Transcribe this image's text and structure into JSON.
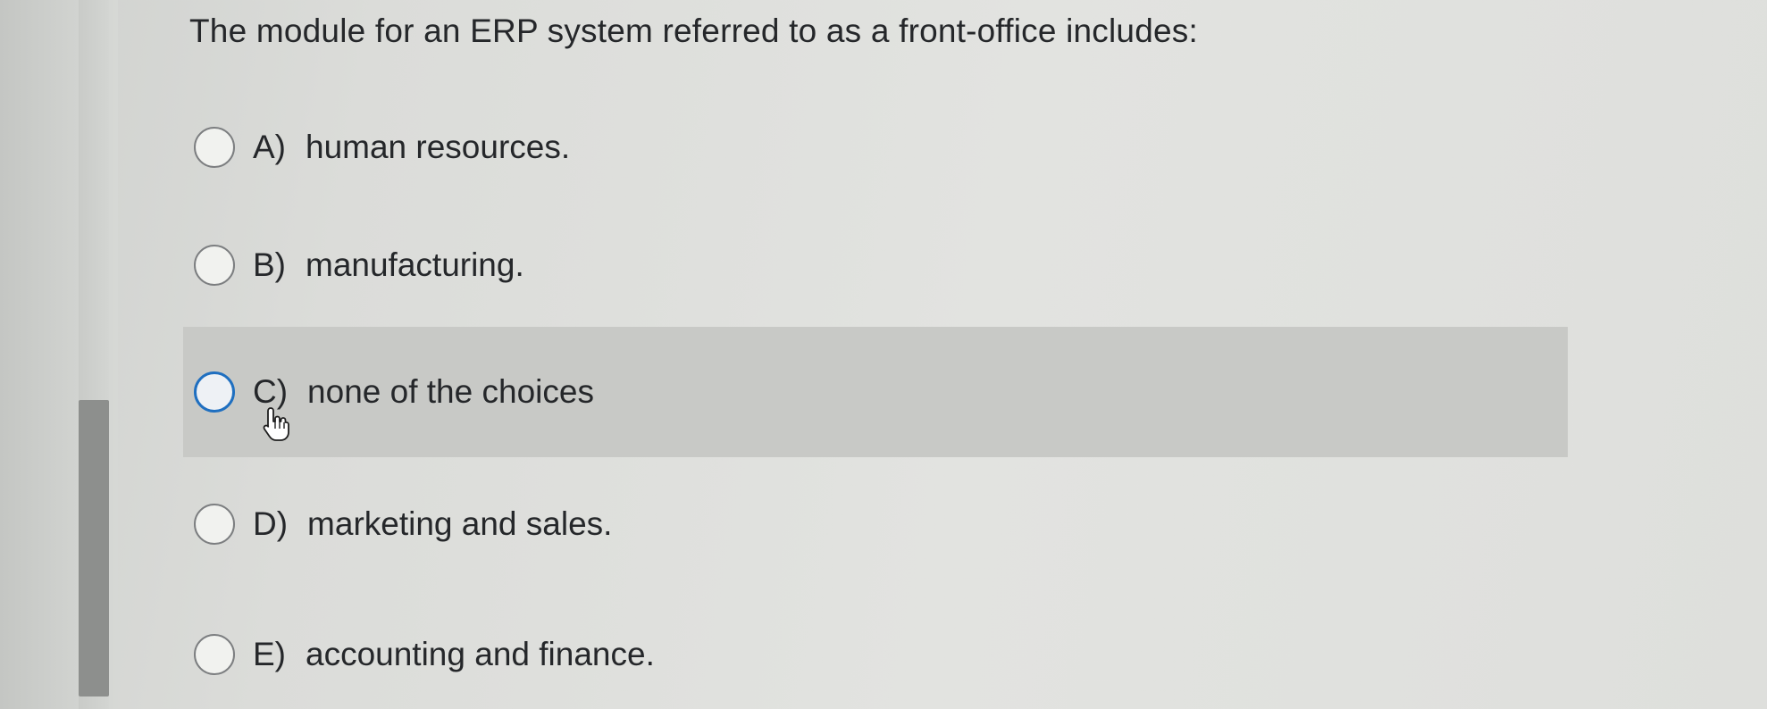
{
  "question": {
    "text": "The module for an ERP system referred to as a front-office includes:"
  },
  "options": [
    {
      "letter": "A)",
      "text": "human resources.",
      "selected": false,
      "hovered": false
    },
    {
      "letter": "B)",
      "text": "manufacturing.",
      "selected": false,
      "hovered": false
    },
    {
      "letter": "C)",
      "text": "none of the choices",
      "selected": false,
      "hovered": true
    },
    {
      "letter": "D)",
      "text": "marketing and sales.",
      "selected": false,
      "hovered": false
    },
    {
      "letter": "E)",
      "text": "accounting and finance.",
      "selected": false,
      "hovered": false
    }
  ],
  "colors": {
    "hover_row": "#c8c9c6",
    "focus_ring": "#1f6fc0",
    "scroll_thumb": "#8d8f8d"
  },
  "icons": {
    "cursor": "hand-pointer-icon"
  }
}
